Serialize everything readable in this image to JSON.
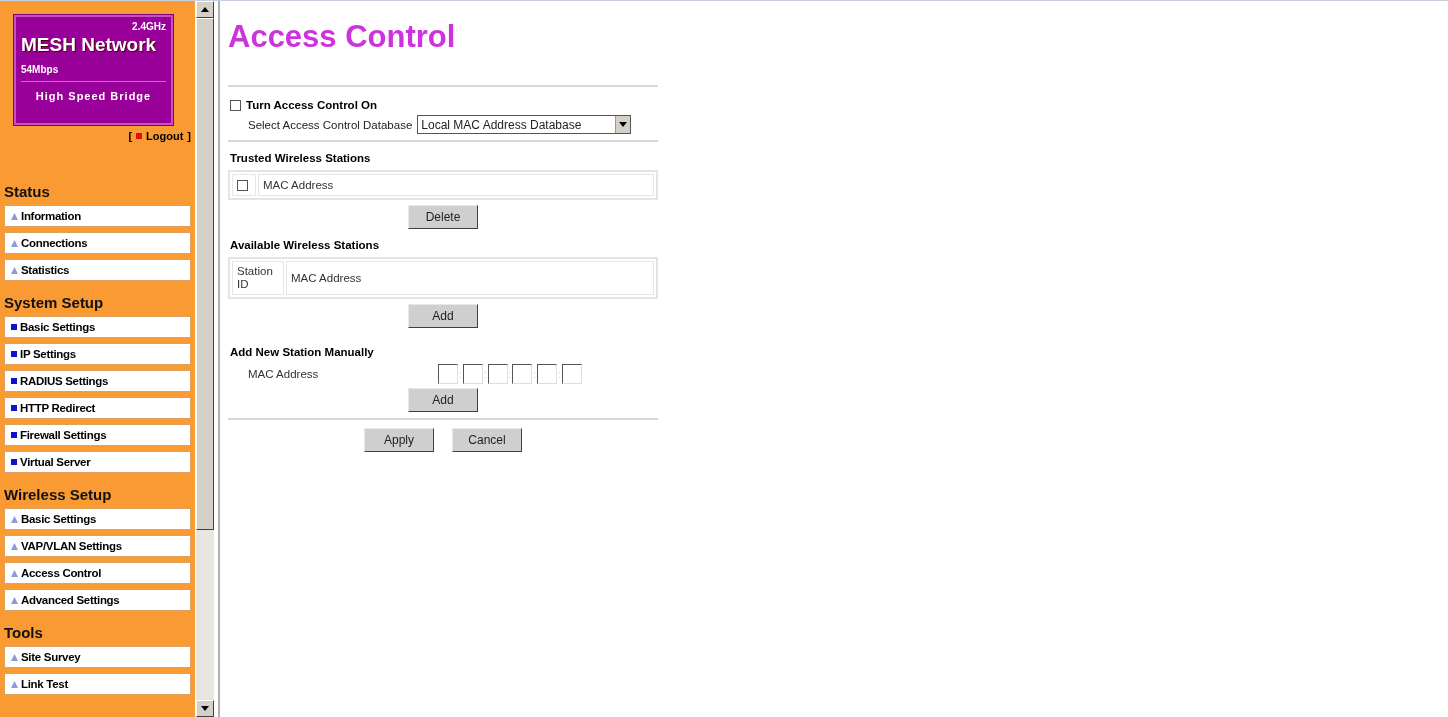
{
  "logo": {
    "band": "2.4GHz",
    "title": "MESH Network",
    "speed": "54Mbps",
    "subtitle": "High Speed Bridge"
  },
  "logout": {
    "open": "[",
    "label": "Logout",
    "close": "]"
  },
  "sidebar": [
    {
      "heading": "Status",
      "kind": "arrow",
      "items": [
        {
          "label": "Information"
        },
        {
          "label": "Connections"
        },
        {
          "label": "Statistics"
        }
      ]
    },
    {
      "heading": "System Setup",
      "kind": "square",
      "items": [
        {
          "label": "Basic Settings"
        },
        {
          "label": "IP Settings"
        },
        {
          "label": "RADIUS Settings"
        },
        {
          "label": "HTTP Redirect"
        },
        {
          "label": "Firewall Settings"
        },
        {
          "label": "Virtual Server"
        }
      ]
    },
    {
      "heading": "Wireless Setup",
      "kind": "arrow",
      "items": [
        {
          "label": "Basic Settings"
        },
        {
          "label": "VAP/VLAN Settings"
        },
        {
          "label": "Access Control"
        },
        {
          "label": "Advanced Settings"
        }
      ]
    },
    {
      "heading": "Tools",
      "kind": "arrow",
      "items": [
        {
          "label": "Site Survey"
        },
        {
          "label": "Link Test"
        }
      ]
    }
  ],
  "page_title": "Access Control",
  "access_control": {
    "label": "Turn Access Control On",
    "checked": false
  },
  "database": {
    "label": "Select Access Control Database",
    "value": "Local MAC Address Database"
  },
  "trusted": {
    "heading": "Trusted Wireless Stations",
    "select_all_checked": false,
    "column": "MAC Address",
    "button": "Delete"
  },
  "available": {
    "heading": "Available Wireless Stations",
    "columns": [
      "Station ID",
      "MAC Address"
    ],
    "button": "Add"
  },
  "manual": {
    "heading": "Add New Station Manually",
    "label": "MAC Address",
    "separator": ":",
    "button": "Add"
  },
  "buttons": [
    "Apply",
    "Cancel"
  ]
}
